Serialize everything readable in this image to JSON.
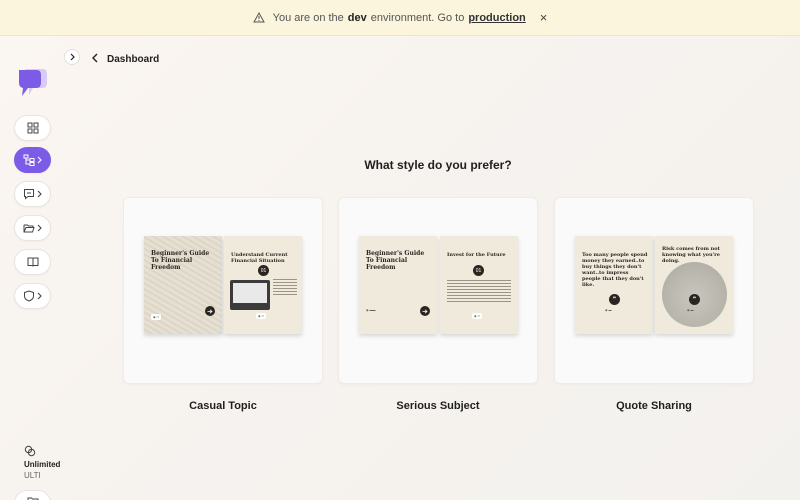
{
  "banner": {
    "text_before": "You are on the",
    "env": "dev",
    "text_after": "environment. Go to",
    "link": "production",
    "close": "×"
  },
  "sidebar": {
    "plan_name": "Unlimited",
    "plan_sub": "ULTI",
    "accent": "#7c5ce6"
  },
  "header": {
    "back_label": "Dashboard"
  },
  "main": {
    "question": "What style do you prefer?",
    "options": [
      {
        "label": "Casual Topic",
        "slides": [
          {
            "title": "Beginner's Guide To Financial Freedom"
          },
          {
            "title": "Understand Current Financial Situation",
            "num": "01"
          }
        ]
      },
      {
        "label": "Serious Subject",
        "slides": [
          {
            "title": "Beginner's Guide To Financial Freedom"
          },
          {
            "title": "Invest for the Future",
            "num": "01"
          }
        ]
      },
      {
        "label": "Quote Sharing",
        "slides": [
          {
            "title": "Too many people spend money they earned..to buy things they don't want..to impress people that they don't like."
          },
          {
            "title": "Risk comes from not knowing what you're doing."
          }
        ]
      }
    ]
  }
}
